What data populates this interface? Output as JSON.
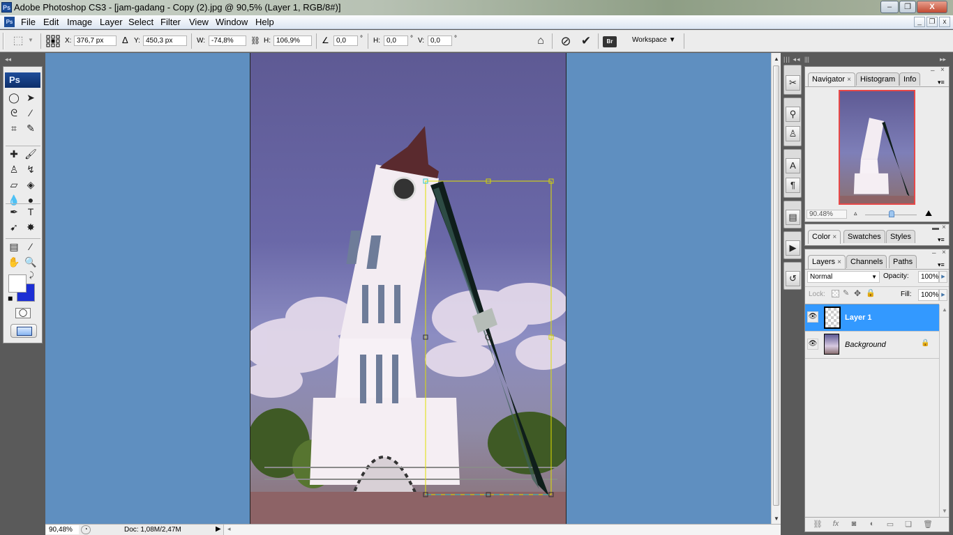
{
  "window": {
    "title": "Adobe Photoshop CS3 - [jam-gadang - Copy (2).jpg @ 90,5% (Layer 1, RGB/8#)]",
    "app_icon": "Ps",
    "minimize": "–",
    "restore": "❐",
    "close": "X"
  },
  "menu": {
    "items": [
      "File",
      "Edit",
      "Image",
      "Layer",
      "Select",
      "Filter",
      "View",
      "Window",
      "Help"
    ],
    "mdi_minimize": "_",
    "mdi_restore": "❐",
    "mdi_close": "x"
  },
  "options": {
    "x_label": "X:",
    "x_value": "376,7 px",
    "delta_icon": "Δ",
    "y_label": "Y:",
    "y_value": "450,3 px",
    "w_label": "W:",
    "w_value": "-74,8%",
    "link_icon": "⛓",
    "h_label": "H:",
    "h_value": "106,9%",
    "angle_icon": "∠",
    "angle_value": "0,0",
    "hskew_label": "H:",
    "hskew_value": "0,0",
    "vskew_label": "V:",
    "vskew_value": "0,0",
    "degree": "°",
    "warp_icon": "⌂",
    "cancel_icon": "⊘",
    "commit_icon": "✔",
    "bridge_icon": "Br",
    "workspace_label": "Workspace ▼"
  },
  "toolbox": {
    "collapse": "◂◂",
    "logo": "Ps",
    "tools": [
      {
        "name": "marquee-tool",
        "glyph": "◯"
      },
      {
        "name": "move-tool",
        "glyph": "➤"
      },
      {
        "name": "lasso-tool",
        "glyph": "ᘓ"
      },
      {
        "name": "magic-wand-tool",
        "glyph": "⁄"
      },
      {
        "name": "crop-tool",
        "glyph": "⌗"
      },
      {
        "name": "slice-tool",
        "glyph": "✎"
      },
      {
        "name": "healing-brush-tool",
        "glyph": "✚"
      },
      {
        "name": "brush-tool",
        "glyph": "🖌"
      },
      {
        "name": "clone-stamp-tool",
        "glyph": "♙"
      },
      {
        "name": "history-brush-tool",
        "glyph": "↯"
      },
      {
        "name": "eraser-tool",
        "glyph": "▱"
      },
      {
        "name": "paint-bucket-tool",
        "glyph": "◈"
      },
      {
        "name": "blur-tool",
        "glyph": "💧"
      },
      {
        "name": "dodge-tool",
        "glyph": "●"
      },
      {
        "name": "pen-tool",
        "glyph": "✒"
      },
      {
        "name": "type-tool",
        "glyph": "T"
      },
      {
        "name": "path-selection-tool",
        "glyph": "➹"
      },
      {
        "name": "custom-shape-tool",
        "glyph": "✸"
      },
      {
        "name": "notes-tool",
        "glyph": "▤"
      },
      {
        "name": "eyedropper-tool",
        "glyph": "⁄"
      },
      {
        "name": "hand-tool",
        "glyph": "✋"
      },
      {
        "name": "zoom-tool",
        "glyph": "🔍"
      }
    ],
    "swap_icon": "⤸",
    "default_colors_icon": "◼",
    "quick_mask_icon": "◯",
    "screen_mode_icon": "▭",
    "foreground_color": "#ffffff",
    "background_color": "#1c2ed4"
  },
  "statusbar": {
    "zoom": "90,48%",
    "doc_info": "Doc: 1,08M/2,47M",
    "arrow": "▶",
    "scroll_left": "◂"
  },
  "navigator_panel": {
    "tabs": [
      "Navigator",
      "Histogram",
      "Info"
    ],
    "active_tab": 0,
    "zoom_value": "90.48%",
    "zoom_slider_fraction": 0.5,
    "minimize": "–",
    "close": "×",
    "menu": "▾≡"
  },
  "color_panel": {
    "tabs": [
      "Color",
      "Swatches",
      "Styles"
    ],
    "active_tab": 0
  },
  "layers_panel": {
    "tabs": [
      "Layers",
      "Channels",
      "Paths"
    ],
    "active_tab": 0,
    "blend_mode": "Normal",
    "opacity_label": "Opacity:",
    "opacity_value": "100%",
    "lock_label": "Lock:",
    "fill_label": "Fill:",
    "fill_value": "100%",
    "layers": [
      {
        "name": "Layer 1",
        "selected": true,
        "visible": true,
        "locked": false
      },
      {
        "name": "Background",
        "selected": false,
        "visible": true,
        "locked": true
      }
    ],
    "footer_icons": [
      "link-layers-icon",
      "fx-icon",
      "layer-mask-icon",
      "adjustment-layer-icon",
      "new-group-icon",
      "new-layer-icon",
      "delete-layer-icon"
    ]
  },
  "dock": {
    "icons": [
      "tools-preset-icon",
      "brushes-icon",
      "clone-source-icon",
      "character-icon",
      "paragraph-icon",
      "layer-comps-icon",
      "actions-icon",
      "history-icon"
    ]
  },
  "colors": {
    "canvas_bg": "#5f8fc0",
    "selection_highlight": "#3399ff",
    "transform_box": "#e0e000"
  }
}
